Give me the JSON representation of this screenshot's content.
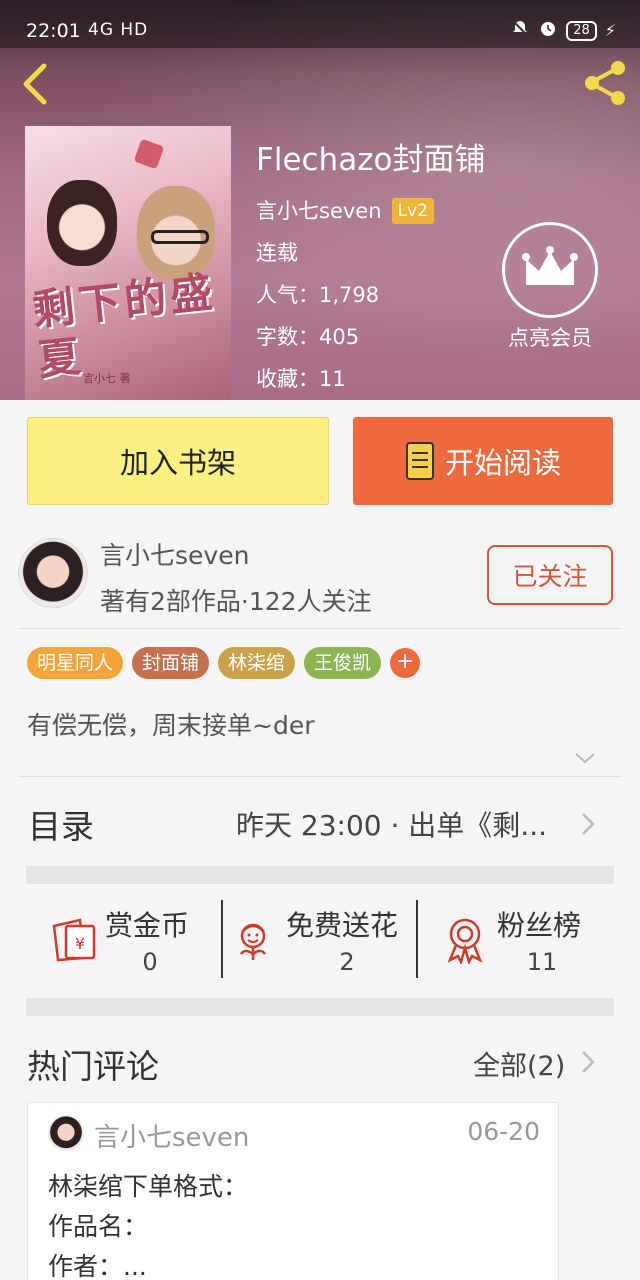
{
  "status_bar": {
    "time": "22:01",
    "network": "4G HD",
    "battery": "28"
  },
  "book": {
    "title": "Flechazo封面铺",
    "author": "言小七seven",
    "level": "Lv2",
    "status": "连载",
    "popularity": "人气：1,798",
    "word_count": "字数：405",
    "favorites": "收藏：11",
    "cover_title": "剩下的盛夏",
    "cover_subtitle": "言小七 著"
  },
  "vip": {
    "label": "点亮会员"
  },
  "actions": {
    "add_shelf": "加入书架",
    "start_read": "开始阅读"
  },
  "author_card": {
    "name": "言小七seven",
    "stats": "著有2部作品·122人关注",
    "follow_label": "已关注"
  },
  "tags": [
    {
      "label": "明星同人",
      "color": "#f3a53a"
    },
    {
      "label": "封面铺",
      "color": "#c5714f"
    },
    {
      "label": "林柒绾",
      "color": "#c9a24a"
    },
    {
      "label": "王俊凯",
      "color": "#8db453"
    }
  ],
  "intro": "有偿无偿，周末接单~der",
  "catalog": {
    "title": "目录",
    "latest": "昨天 23:00 · 出单《剩..."
  },
  "stats": [
    {
      "label": "赏金币",
      "value": "0"
    },
    {
      "label": "免费送花",
      "value": "2"
    },
    {
      "label": "粉丝榜",
      "value": "11"
    }
  ],
  "comments": {
    "title": "热门评论",
    "all_label": "全部(2)",
    "items": [
      {
        "author": "言小七seven",
        "date": "06-20",
        "lines": [
          "林柒绾下单格式：",
          "作品名：",
          "作者：..."
        ]
      }
    ]
  },
  "colors": {
    "accent": "#ee6a3e",
    "shelf_button": "#fbf183",
    "icon_red": "#d23a2a"
  },
  "icons": {
    "back": "chevron-left-icon",
    "share": "share-icon",
    "vip": "crown-icon",
    "read": "book-icon",
    "expand": "chevron-down-icon",
    "reward": "coin-envelope-icon",
    "flower": "flower-icon",
    "fans": "medal-icon"
  }
}
